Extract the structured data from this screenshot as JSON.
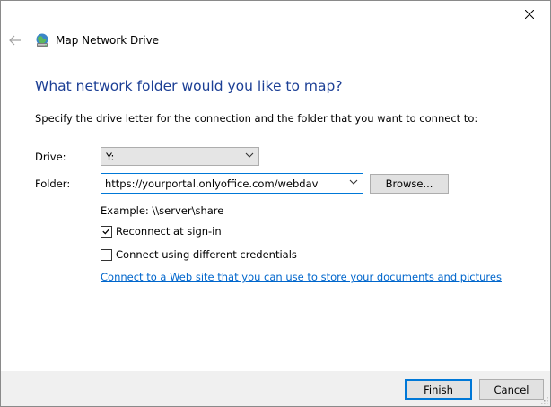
{
  "window": {
    "title": "Map Network Drive"
  },
  "heading": "What network folder would you like to map?",
  "instruction": "Specify the drive letter for the connection and the folder that you want to connect to:",
  "drive": {
    "label": "Drive:",
    "value": "Y:"
  },
  "folder": {
    "label": "Folder:",
    "value": "https://yourportal.onlyoffice.com/webdav"
  },
  "browse_label": "Browse...",
  "example": "Example: \\\\server\\share",
  "reconnect": {
    "label": "Reconnect at sign-in",
    "checked": true
  },
  "different_credentials": {
    "label": "Connect using different credentials",
    "checked": false
  },
  "web_link": {
    "text": "Connect to a Web site that you can use to store your documents and pictures",
    "trailing": "."
  },
  "footer": {
    "finish_label": "Finish",
    "cancel_label": "Cancel"
  },
  "icons": {
    "close": "close-icon",
    "back": "back-arrow-icon",
    "app": "network-drive-icon",
    "dropdown": "chevron-down-icon",
    "check": "checkmark-icon",
    "grip": "resize-grip-icon"
  },
  "colors": {
    "heading": "#1c3f95",
    "link": "#0066cc",
    "focus_border": "#0078d7",
    "footer_bg": "#f0f0f0",
    "button_bg": "#e1e1e1"
  }
}
